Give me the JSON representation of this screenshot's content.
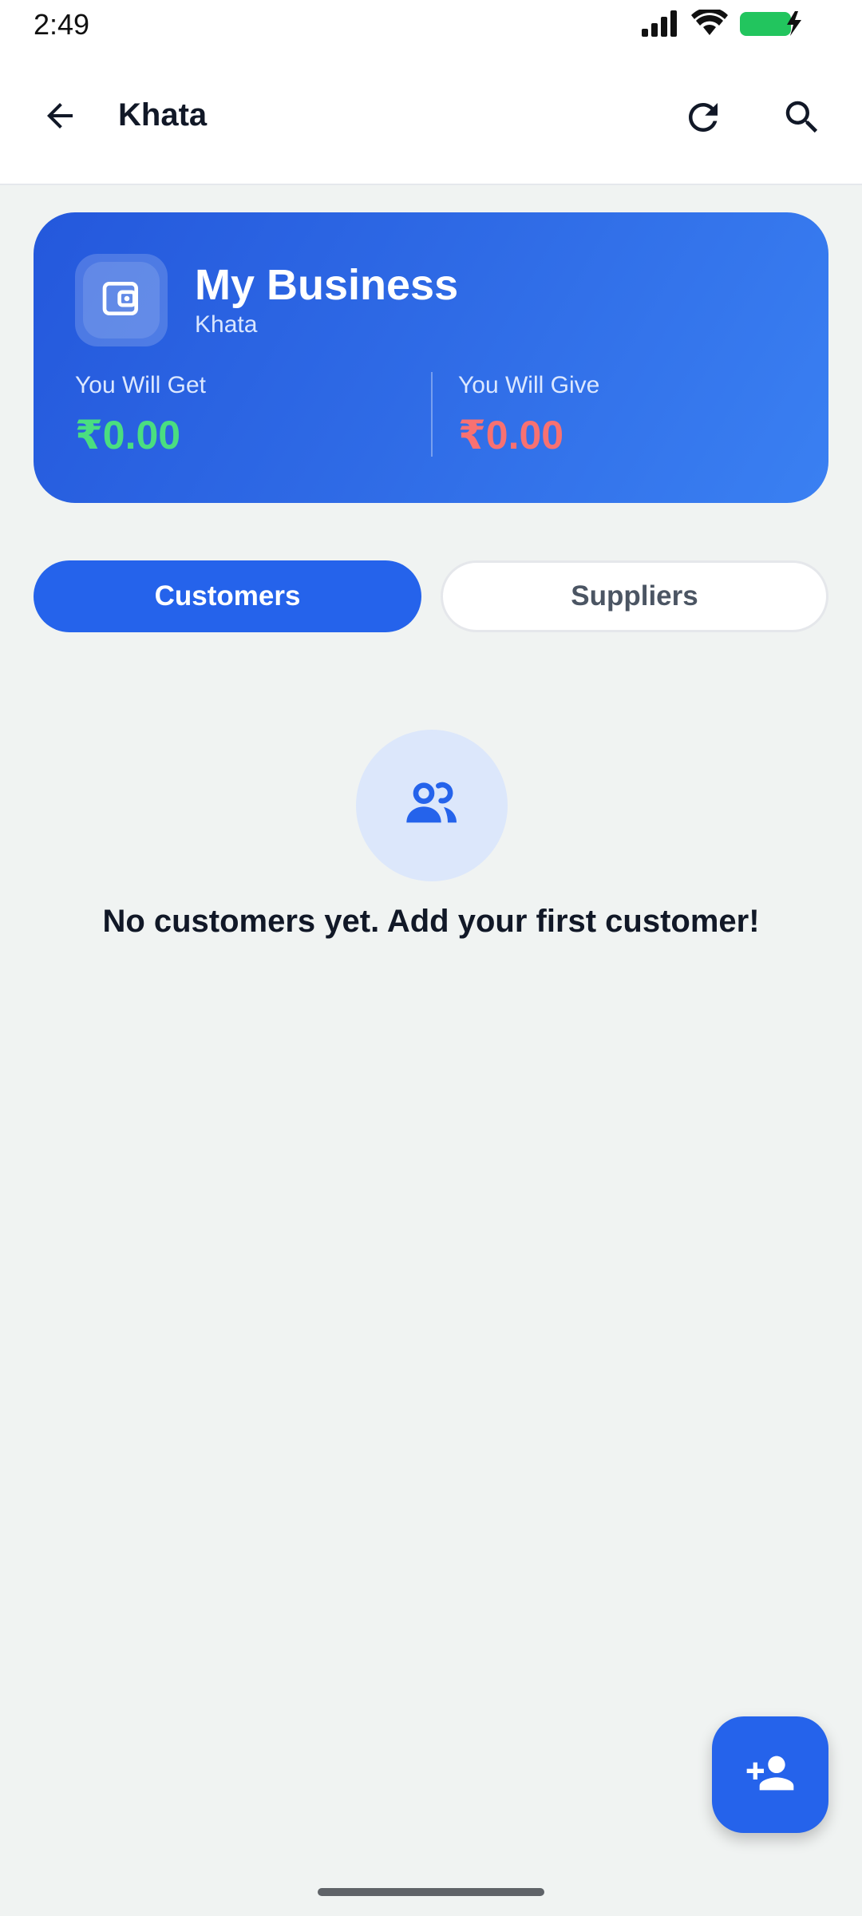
{
  "status_bar": {
    "time": "2:49",
    "icons": [
      "signal-icon",
      "wifi-icon",
      "battery-charging-icon"
    ],
    "battery_color": "#22C55E"
  },
  "app_bar": {
    "title": "Khata",
    "icons": [
      "arrow-back-icon",
      "refresh-icon",
      "search-icon"
    ]
  },
  "business_card": {
    "name": "My Business",
    "subtitle": "Khata",
    "get_label": "You Will Get",
    "get_value": "₹0.00",
    "give_label": "You Will Give",
    "give_value": "₹0.00",
    "colors": {
      "card": "#2E66E4",
      "get": "#4ADE80",
      "give": "#F87171"
    },
    "icon": "wallet-icon"
  },
  "tabs": [
    {
      "label": "Customers",
      "selected": true
    },
    {
      "label": "Suppliers",
      "selected": false
    }
  ],
  "empty_state": {
    "icon": "people-icon",
    "message": "No customers yet. Add your first customer!"
  },
  "fab": {
    "icon": "add-person-icon"
  },
  "colors": {
    "accent": "#2563EB",
    "background": "#F0F3F2"
  }
}
